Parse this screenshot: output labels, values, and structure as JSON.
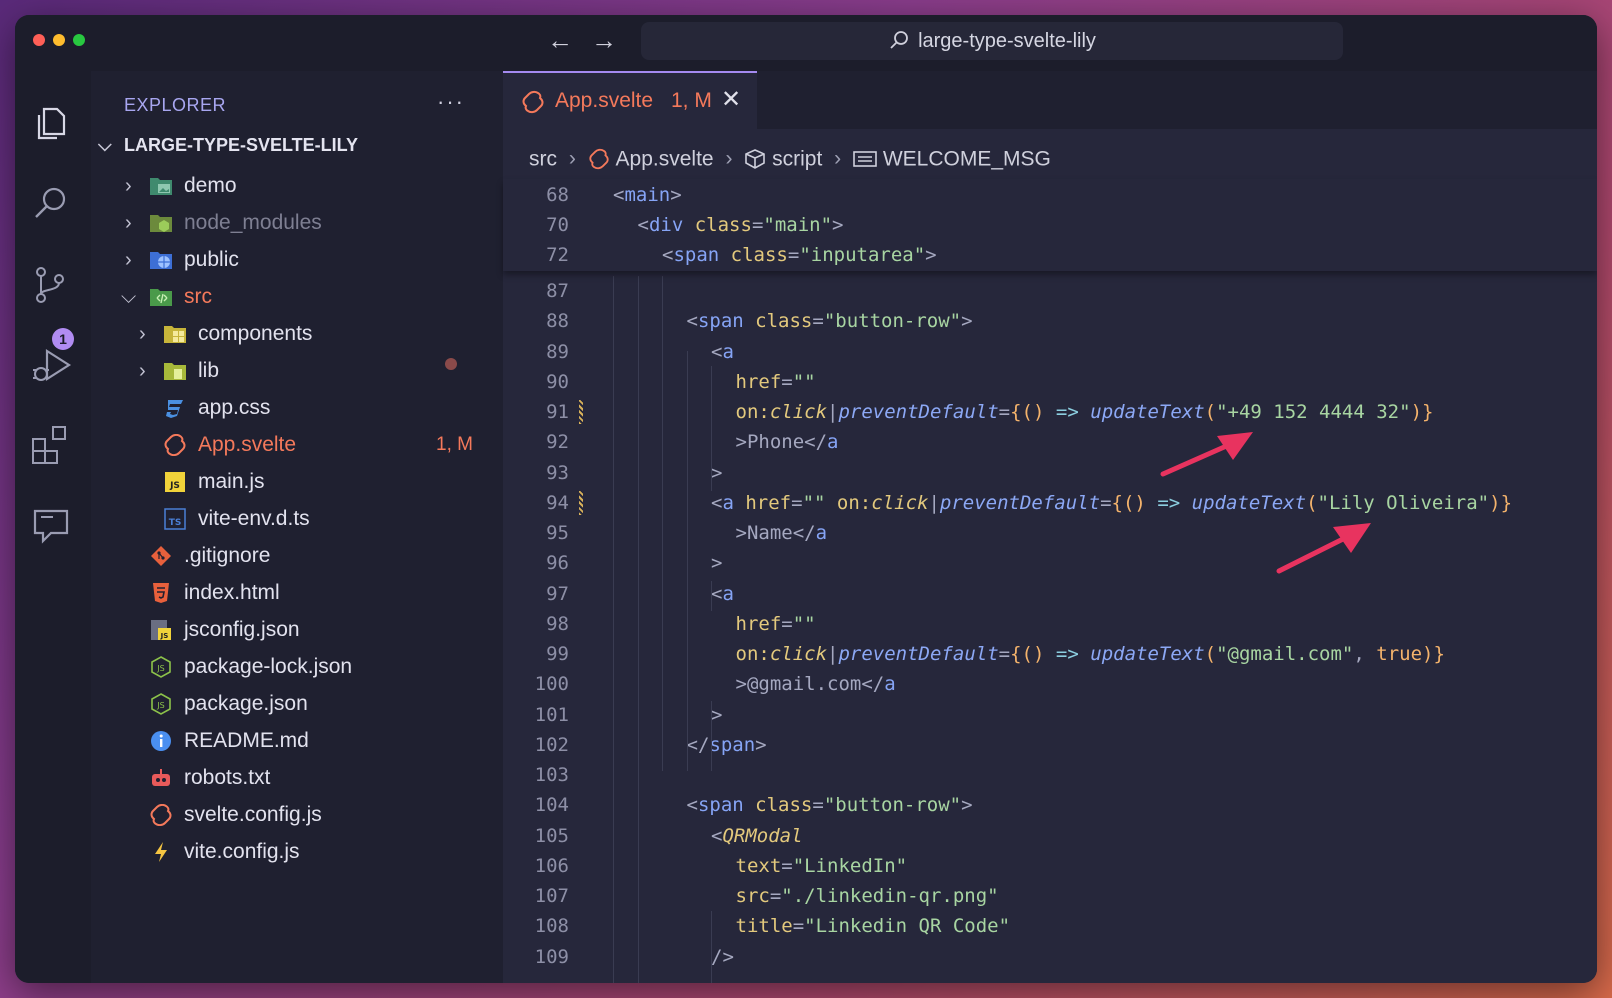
{
  "window": {
    "search_text": "large-type-svelte-lily"
  },
  "activity_bar": {
    "scm_badge": "1"
  },
  "sidebar": {
    "title": "EXPLORER",
    "more": "···",
    "root": "LARGE-TYPE-SVELTE-LILY",
    "items": [
      {
        "label": "demo"
      },
      {
        "label": "node_modules"
      },
      {
        "label": "public"
      },
      {
        "label": "src"
      },
      {
        "label": "components"
      },
      {
        "label": "lib"
      },
      {
        "label": "app.css"
      },
      {
        "label": "App.svelte",
        "status": "1, M"
      },
      {
        "label": "main.js"
      },
      {
        "label": "vite-env.d.ts"
      },
      {
        "label": ".gitignore"
      },
      {
        "label": "index.html"
      },
      {
        "label": "jsconfig.json"
      },
      {
        "label": "package-lock.json"
      },
      {
        "label": "package.json"
      },
      {
        "label": "README.md"
      },
      {
        "label": "robots.txt"
      },
      {
        "label": "svelte.config.js"
      },
      {
        "label": "vite.config.js"
      }
    ]
  },
  "tab": {
    "label": "App.svelte",
    "status": "1, M"
  },
  "breadcrumb": {
    "items": [
      "src",
      "App.svelte",
      "script",
      "WELCOME_MSG"
    ]
  },
  "code": {
    "sticky": [
      {
        "n": "68",
        "indent": 0,
        "text": "<main>"
      },
      {
        "n": "70",
        "indent": 1,
        "text": "<div class=\"main\">"
      },
      {
        "n": "72",
        "indent": 2,
        "text": "<span class=\"inputarea\">"
      }
    ],
    "lines": [
      {
        "n": "87",
        "indent": 0,
        "text": ""
      },
      {
        "n": "88",
        "indent": 3,
        "text": "<span class=\"button-row\">"
      },
      {
        "n": "89",
        "indent": 4,
        "text": "<a"
      },
      {
        "n": "90",
        "indent": 5,
        "text": "href=\"\""
      },
      {
        "n": "91",
        "indent": 5,
        "text": "on:click|preventDefault={() => updateText(\"+49 152 4444 32\")}"
      },
      {
        "n": "92",
        "indent": 5,
        "text": ">Phone</a"
      },
      {
        "n": "93",
        "indent": 4,
        "text": ">"
      },
      {
        "n": "94",
        "indent": 4,
        "text": "<a href=\"\" on:click|preventDefault={() => updateText(\"Lily Oliveira\")}"
      },
      {
        "n": "95",
        "indent": 5,
        "text": ">Name</a"
      },
      {
        "n": "96",
        "indent": 4,
        "text": ">"
      },
      {
        "n": "97",
        "indent": 4,
        "text": "<a"
      },
      {
        "n": "98",
        "indent": 5,
        "text": "href=\"\""
      },
      {
        "n": "99",
        "indent": 5,
        "text": "on:click|preventDefault={() => updateText(\"@gmail.com\", true)}"
      },
      {
        "n": "100",
        "indent": 5,
        "text": ">@gmail.com</a"
      },
      {
        "n": "101",
        "indent": 4,
        "text": ">"
      },
      {
        "n": "102",
        "indent": 3,
        "text": "</span>"
      },
      {
        "n": "103",
        "indent": 0,
        "text": ""
      },
      {
        "n": "104",
        "indent": 3,
        "text": "<span class=\"button-row\">"
      },
      {
        "n": "105",
        "indent": 4,
        "text": "<QRModal"
      },
      {
        "n": "106",
        "indent": 5,
        "text": "text=\"LinkedIn\""
      },
      {
        "n": "107",
        "indent": 5,
        "text": "src=\"./linkedin-qr.png\""
      },
      {
        "n": "108",
        "indent": 5,
        "text": "title=\"Linkedin QR Code\""
      },
      {
        "n": "109",
        "indent": 4,
        "text": "/>"
      }
    ]
  },
  "colors": {
    "accent": "#a48af0",
    "modified": "#f4795b",
    "arrow": "#e8335f"
  }
}
